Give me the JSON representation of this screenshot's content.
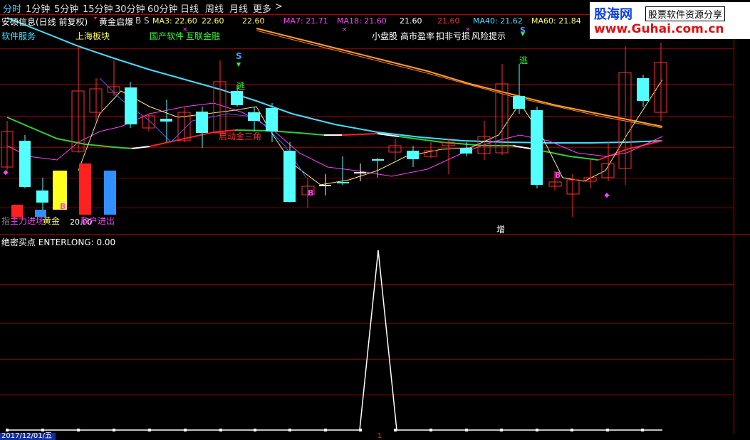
{
  "toolbar": {
    "periods": [
      "分时",
      "1分钟",
      "5分钟",
      "15分钟",
      "30分钟",
      "60分钟",
      "日线",
      "周线",
      "月线",
      "更多"
    ],
    "more_arrow": ">"
  },
  "main": {
    "stock_title": "安硕信息(日线 前复权)",
    "indicator_name": "黄金启爆",
    "bs_label": "B S",
    "ma_labels": [
      "MA3: 22.60",
      "22.60",
      "22.60",
      "MA7: 21.71",
      "MA18: 21.60",
      "21.60",
      "21.60",
      "MA40: 21.62",
      "MA60: 21.84"
    ],
    "concepts": [
      "软件服务",
      "上海板块",
      "国产软件",
      "互联金融",
      "小盘股",
      "高市盈率",
      "扣非亏损",
      "风险提示"
    ],
    "annotations": {
      "s_marks": [
        "S",
        "S"
      ],
      "escape_marks": [
        "逃",
        "逃"
      ],
      "b_marks": [
        "B",
        "B",
        "B"
      ],
      "start_label": "启动金三角",
      "big_money": "主力进场",
      "gold_label": "黄金",
      "retail_label": "散户进出",
      "value_label": "20.00",
      "index_label": "指",
      "increase_label": "增"
    }
  },
  "lower": {
    "title": "绝密买点 ENTERLONG: 0.00"
  },
  "footer": {
    "date": "2017/12/01/五",
    "marker": "1"
  },
  "logo": {
    "brand": "股海网",
    "tagline": "股票软件资源分享",
    "url": "www.Guhai.com.cn"
  },
  "colors": {
    "up": "#ff3030",
    "down": "#54ffff",
    "ma3": "#ffff80",
    "ma7": "#ff40ff",
    "ma40": "#40e0ff",
    "ma60": "#ffa020",
    "signal": "#ffffff",
    "grid": "#8a0000"
  }
}
